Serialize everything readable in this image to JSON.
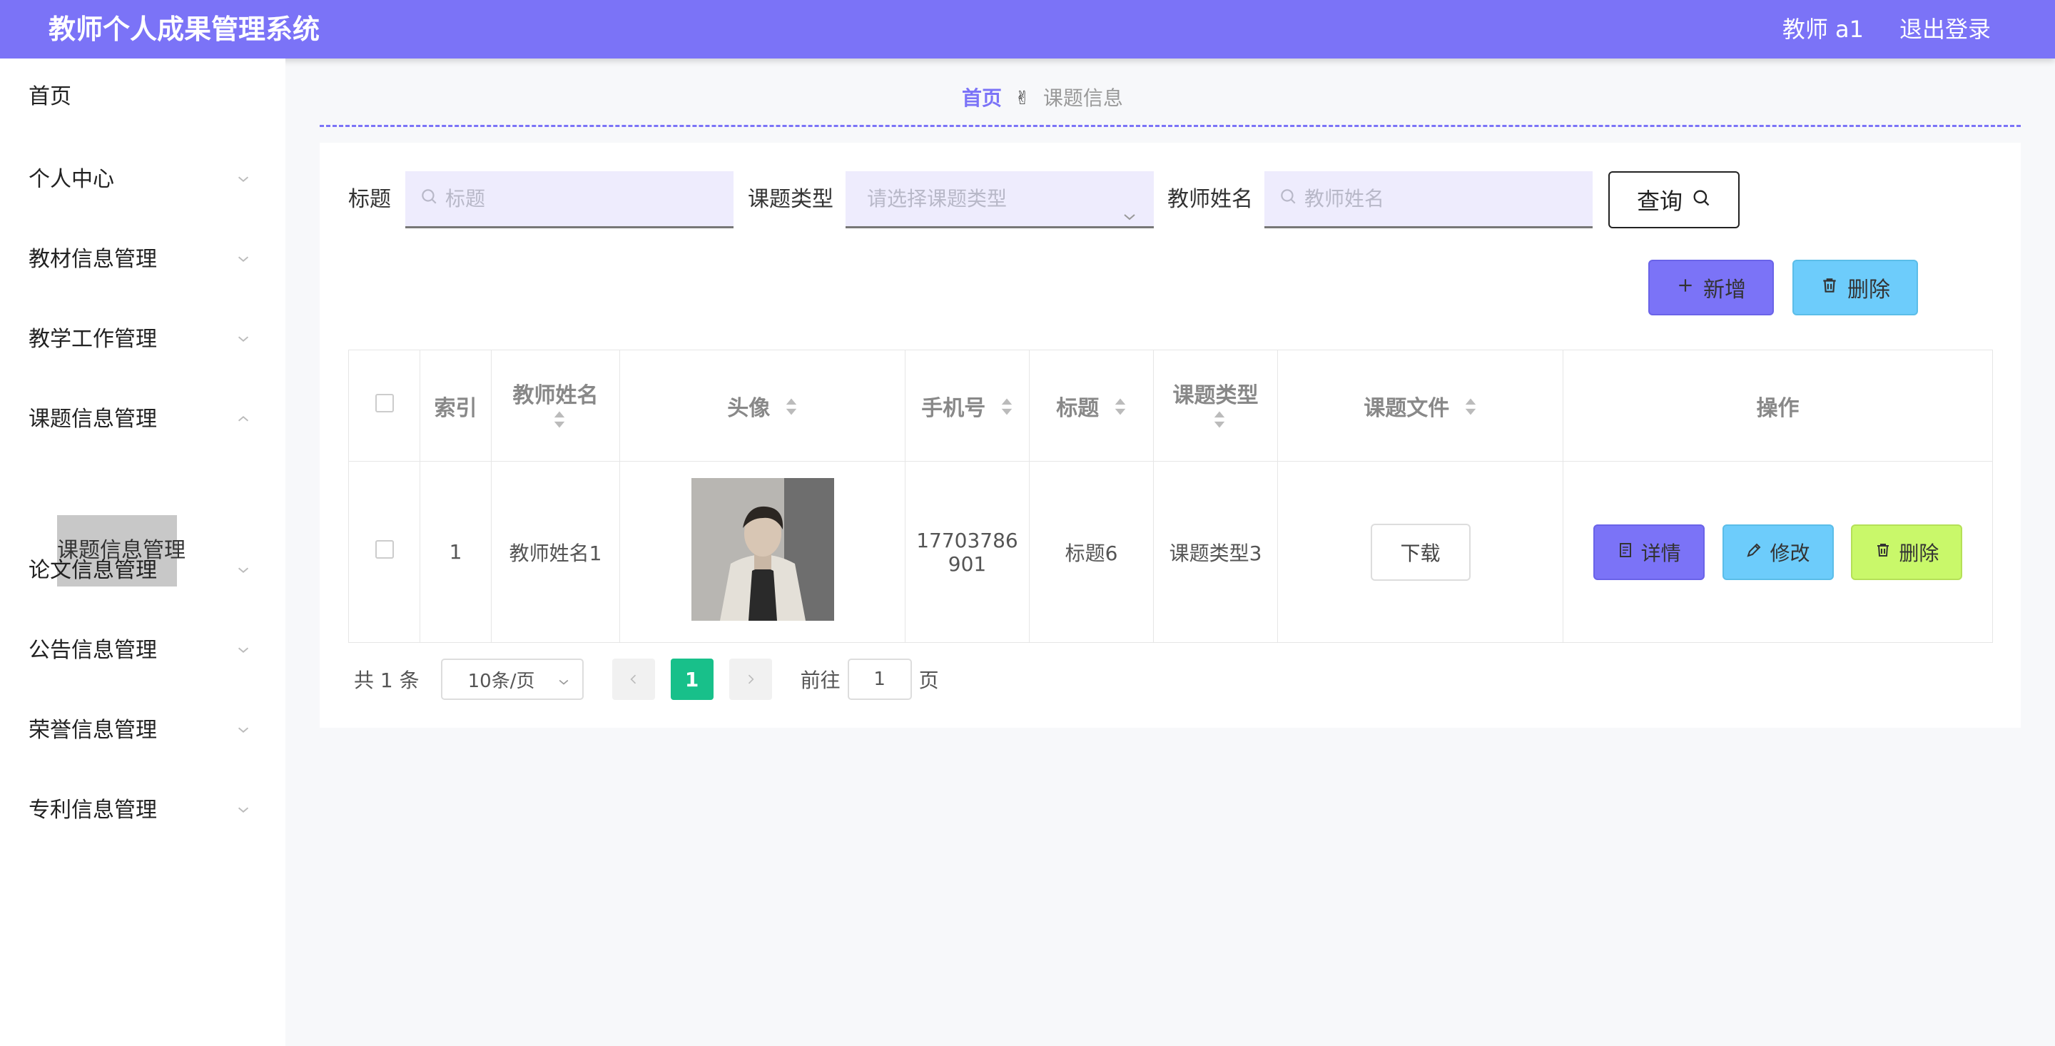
{
  "header": {
    "title": "教师个人成果管理系统",
    "user": "教师 a1",
    "logout": "退出登录"
  },
  "sidebar": {
    "items": [
      {
        "label": "首页",
        "expandable": false
      },
      {
        "label": "个人中心",
        "expandable": true
      },
      {
        "label": "教材信息管理",
        "expandable": true
      },
      {
        "label": "教学工作管理",
        "expandable": true
      },
      {
        "label": "课题信息管理",
        "expandable": true,
        "expanded": true
      },
      {
        "label": "论文信息管理",
        "expandable": true
      },
      {
        "label": "公告信息管理",
        "expandable": true
      },
      {
        "label": "荣誉信息管理",
        "expandable": true
      },
      {
        "label": "专利信息管理",
        "expandable": true
      }
    ],
    "active_sub": "课题信息管理"
  },
  "breadcrumb": {
    "home": "首页",
    "separator": "✌",
    "current": "课题信息"
  },
  "search": {
    "title_label": "标题",
    "title_placeholder": "标题",
    "type_label": "课题类型",
    "type_placeholder": "请选择课题类型",
    "teacher_label": "教师姓名",
    "teacher_placeholder": "教师姓名",
    "query_label": "查询"
  },
  "actions": {
    "add_label": "新增",
    "delete_label": "删除"
  },
  "table": {
    "headers": {
      "index": "索引",
      "teacher": "教师姓名",
      "avatar": "头像",
      "phone": "手机号",
      "title": "标题",
      "type": "课题类型",
      "file": "课题文件",
      "ops": "操作"
    },
    "rows": [
      {
        "index": "1",
        "teacher": "教师姓名1",
        "phone_line1": "17703786",
        "phone_line2": "901",
        "title": "标题6",
        "type": "课题类型3",
        "download": "下载",
        "detail": "详情",
        "edit": "修改",
        "delete": "删除"
      }
    ]
  },
  "pagination": {
    "total": "共 1 条",
    "page_size": "10条/页",
    "current_page": "1",
    "goto_label": "前往",
    "goto_value": "1",
    "page_suffix": "页"
  },
  "colors": {
    "primary": "#7b73f7",
    "info": "#6dccfb",
    "success": "#18c08a",
    "lime": "#c9f86a"
  }
}
